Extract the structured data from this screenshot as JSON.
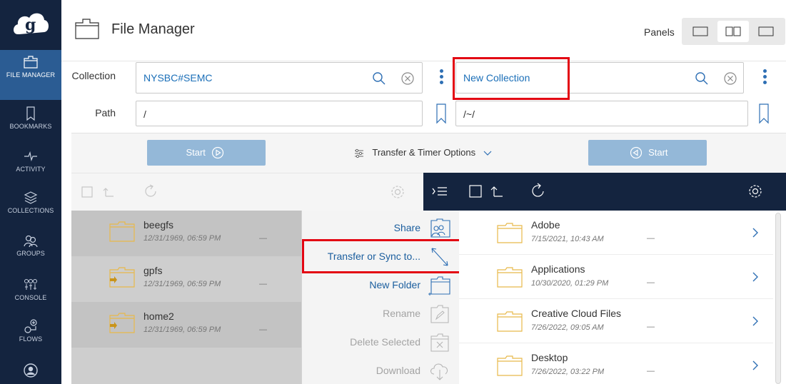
{
  "app": {
    "title": "File Manager",
    "panels_label": "Panels",
    "accent_color": "#2b5c93",
    "sidebar_color": "#14243f"
  },
  "sidebar": {
    "items": [
      {
        "label": "FILE MANAGER",
        "icon": "folder-icon",
        "active": true
      },
      {
        "label": "BOOKMARKS",
        "icon": "bookmark-icon",
        "active": false
      },
      {
        "label": "ACTIVITY",
        "icon": "activity-icon",
        "active": false
      },
      {
        "label": "COLLECTIONS",
        "icon": "collections-icon",
        "active": false
      },
      {
        "label": "GROUPS",
        "icon": "groups-icon",
        "active": false
      },
      {
        "label": "CONSOLE",
        "icon": "console-icon",
        "active": false
      },
      {
        "label": "FLOWS",
        "icon": "flows-icon",
        "active": false
      },
      {
        "label": "",
        "icon": "account-icon",
        "active": false
      }
    ]
  },
  "collection": {
    "label": "Collection",
    "path_label": "Path",
    "left_value": "NYSBC#SEMC",
    "right_value": "New Collection",
    "left_path": "/",
    "right_path": "/~/"
  },
  "transfer": {
    "start_left": "Start",
    "start_right": "Start",
    "options_label": "Transfer & Timer Options"
  },
  "left_panel": {
    "rows": [
      {
        "name": "beegfs",
        "date": "12/31/1969, 06:59 PM",
        "size": "—"
      },
      {
        "name": "gpfs",
        "date": "12/31/1969, 06:59 PM",
        "size": "—"
      },
      {
        "name": "home2",
        "date": "12/31/1969, 06:59 PM",
        "size": "—"
      }
    ]
  },
  "context_menu": {
    "items": [
      {
        "label": "Share",
        "icon": "share-icon",
        "enabled": true
      },
      {
        "label": "Transfer or Sync to...",
        "icon": "transfer-icon",
        "enabled": true
      },
      {
        "label": "New Folder",
        "icon": "new-folder-icon",
        "enabled": true
      },
      {
        "label": "Rename",
        "icon": "rename-icon",
        "enabled": false
      },
      {
        "label": "Delete Selected",
        "icon": "delete-icon",
        "enabled": false
      },
      {
        "label": "Download",
        "icon": "download-icon",
        "enabled": false
      }
    ]
  },
  "right_panel": {
    "rows": [
      {
        "name": "Adobe",
        "date": "7/15/2021, 10:43 AM",
        "size": "—"
      },
      {
        "name": "Applications",
        "date": "10/30/2020, 01:29 PM",
        "size": "—"
      },
      {
        "name": "Creative Cloud Files",
        "date": "7/26/2022, 09:05 AM",
        "size": "—"
      },
      {
        "name": "Desktop",
        "date": "7/26/2022, 03:22 PM",
        "size": "—"
      }
    ]
  }
}
